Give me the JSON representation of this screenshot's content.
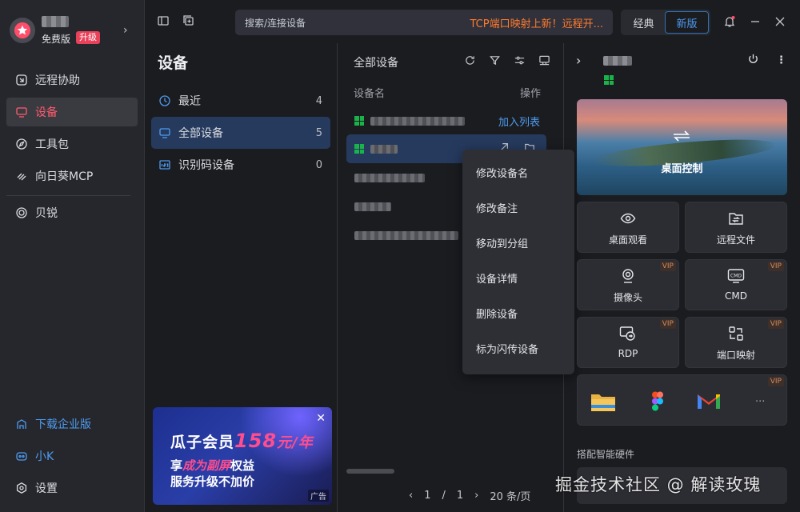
{
  "user": {
    "plan": "免费版",
    "upgrade_label": "升级"
  },
  "nav": {
    "items": [
      {
        "label": "远程协助",
        "icon": "remote-assist-icon"
      },
      {
        "label": "设备",
        "icon": "device-icon",
        "active": true
      },
      {
        "label": "工具包",
        "icon": "compass-icon"
      },
      {
        "label": "向日葵MCP",
        "icon": "mcp-icon"
      },
      {
        "label": "贝锐",
        "icon": "oray-icon"
      }
    ],
    "bottom": [
      {
        "label": "下载企业版",
        "icon": "enterprise-icon"
      },
      {
        "label": "小K",
        "icon": "assistant-icon"
      },
      {
        "label": "设置",
        "icon": "settings-icon"
      }
    ]
  },
  "topbar": {
    "search_placeholder": "搜索/连接设备",
    "promo": "TCP端口映射上新！远程开...",
    "modes": [
      "经典",
      "新版"
    ],
    "active_mode": "新版"
  },
  "groups": {
    "title": "设备",
    "items": [
      {
        "label": "最近",
        "count": "4"
      },
      {
        "label": "全部设备",
        "count": "5",
        "active": true
      },
      {
        "label": "识别码设备",
        "count": "0"
      }
    ]
  },
  "ad": {
    "title": "瓜子会员",
    "price": "158",
    "unit": "元/年",
    "line1_prefix": "享",
    "line1_em": "成为副屏",
    "line1_suffix": "权益",
    "line2": "服务升级不加价",
    "tag": "广告"
  },
  "device_list": {
    "title": "全部设备",
    "col_name": "设备名",
    "col_op": "操作",
    "add_to_list": "加入列表",
    "pager": {
      "current": "1",
      "sep": "/",
      "total": "1",
      "page_size": "20 条/页"
    }
  },
  "context_menu": [
    "修改设备名",
    "修改备注",
    "移动到分组",
    "设备详情",
    "删除设备",
    "标为闪传设备"
  ],
  "panel": {
    "hero_label": "桌面控制",
    "tiles": [
      {
        "label": "桌面观看",
        "vip": ""
      },
      {
        "label": "远程文件",
        "vip": ""
      },
      {
        "label": "摄像头",
        "vip": "VIP"
      },
      {
        "label": "CMD",
        "vip": "VIP"
      },
      {
        "label": "RDP",
        "vip": "VIP"
      },
      {
        "label": "端口映射",
        "vip": "VIP"
      }
    ],
    "apps_vip": "VIP",
    "apps_more": "...",
    "hardware_title": "搭配智能硬件"
  },
  "watermark": "掘金技术社区 @ 解读玫瑰",
  "colors": {
    "accent_red": "#ff5b6e",
    "accent_blue": "#4e9cf0",
    "promo_orange": "#ff7a30",
    "vip": "#d58a5a"
  }
}
